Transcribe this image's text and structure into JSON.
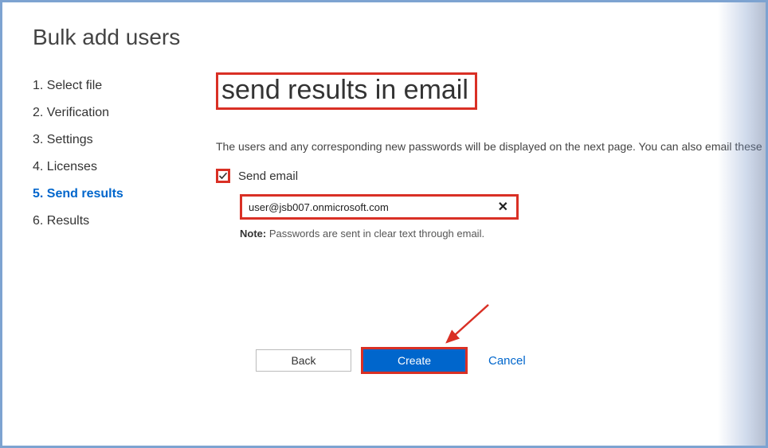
{
  "page_title": "Bulk add users",
  "steps": [
    {
      "num": "1.",
      "label": "Select file"
    },
    {
      "num": "2.",
      "label": "Verification"
    },
    {
      "num": "3.",
      "label": "Settings"
    },
    {
      "num": "4.",
      "label": "Licenses"
    },
    {
      "num": "5.",
      "label": "Send results"
    },
    {
      "num": "6.",
      "label": "Results"
    }
  ],
  "active_step_index": 4,
  "main_heading": "send results in email",
  "description": "The users and any corresponding new passwords will be displayed on the next page. You can also email these",
  "send_email": {
    "checked": true,
    "label": "Send email",
    "value": "user@jsb007.onmicrosoft.com",
    "note_prefix": "Note:",
    "note_text": " Passwords are sent in clear text through email."
  },
  "buttons": {
    "back": "Back",
    "create": "Create",
    "cancel": "Cancel"
  },
  "annotation_highlights": [
    "main_heading",
    "send_email_checkbox",
    "email_input",
    "create_button"
  ],
  "annotation_arrow_target": "create_button"
}
